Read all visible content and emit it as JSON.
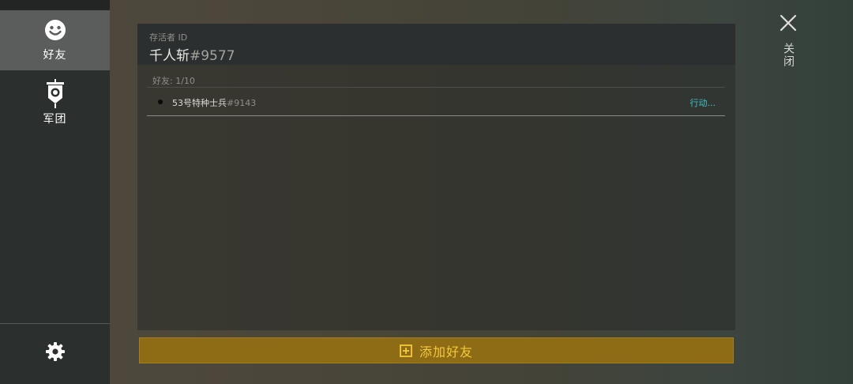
{
  "sidebar": {
    "items": [
      {
        "label": "好友",
        "icon": "smiley-icon",
        "active": true
      },
      {
        "label": "军团",
        "icon": "banner-icon",
        "active": false
      }
    ],
    "settings_icon": "gear-icon"
  },
  "panel": {
    "survivor_id_label": "存活者 ID",
    "player_name": "千人斩",
    "player_tag": "#9577",
    "friends_count": "好友: 1/10",
    "friends": [
      {
        "name": "53号特种士兵",
        "tag": "#9143",
        "action": "行动..."
      }
    ]
  },
  "add_friend_label": "添加好友",
  "close_label": "关闭",
  "colors": {
    "accent_gold": "#8e6b15",
    "accent_gold_text": "#f6c93b",
    "action_cyan": "#3fc3c9",
    "sidebar_bg": "#2b2f2d",
    "sidebar_active": "#5a5d5b"
  }
}
